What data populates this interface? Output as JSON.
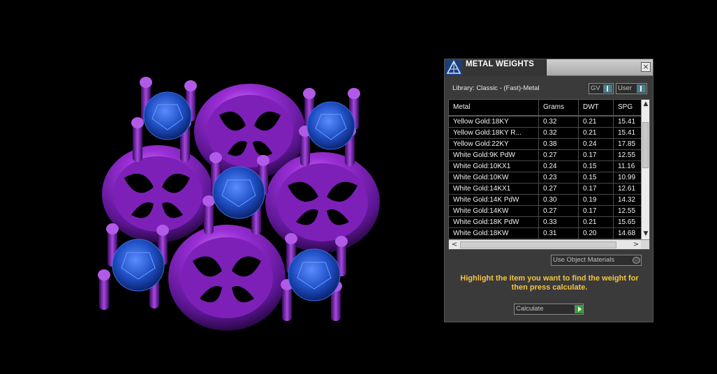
{
  "panel": {
    "title": "METAL WEIGHTS",
    "close_glyph": "×",
    "logo_icon": "gemvision-logo-icon",
    "library_label": "Library: Classic - (Fast)-Metal",
    "gv_toggle_label": "GV",
    "user_toggle_label": "User",
    "use_object_materials_label": "Use Object Materials",
    "instructions": "Highlight the item you want to find the weight for then press calculate.",
    "calculate_label": "Calculate"
  },
  "table": {
    "columns": [
      "Metal",
      "Grams",
      "DWT",
      "SPG"
    ],
    "rows": [
      [
        "Yellow Gold:18KY",
        "0.32",
        "0.21",
        "15.41"
      ],
      [
        "Yellow Gold:18KY R...",
        "0.32",
        "0.21",
        "15.41"
      ],
      [
        "Yellow Gold:22KY",
        "0.38",
        "0.24",
        "17.85"
      ],
      [
        "White Gold:9K PdW",
        "0.27",
        "0.17",
        "12.55"
      ],
      [
        "White Gold:10KX1",
        "0.24",
        "0.15",
        "11.16"
      ],
      [
        "White Gold:10KW",
        "0.23",
        "0.15",
        "10.99"
      ],
      [
        "White Gold:14KX1",
        "0.27",
        "0.17",
        "12.61"
      ],
      [
        "White Gold:14K PdW",
        "0.30",
        "0.19",
        "14.32"
      ],
      [
        "White Gold:14KW",
        "0.27",
        "0.17",
        "12.55"
      ],
      [
        "White Gold:18K PdW",
        "0.33",
        "0.21",
        "15.65"
      ],
      [
        "White Gold:18KW",
        "0.31",
        "0.20",
        "14.68"
      ]
    ],
    "scroll_up_glyph": "▲",
    "scroll_down_glyph": "▼",
    "scroll_left_glyph": "<",
    "scroll_right_glyph": ">"
  },
  "colors": {
    "metal": "#8a22c7",
    "gem": "#1f4fc4",
    "instructions": "#f5c542",
    "accent_toggle": "#4a7d88"
  }
}
